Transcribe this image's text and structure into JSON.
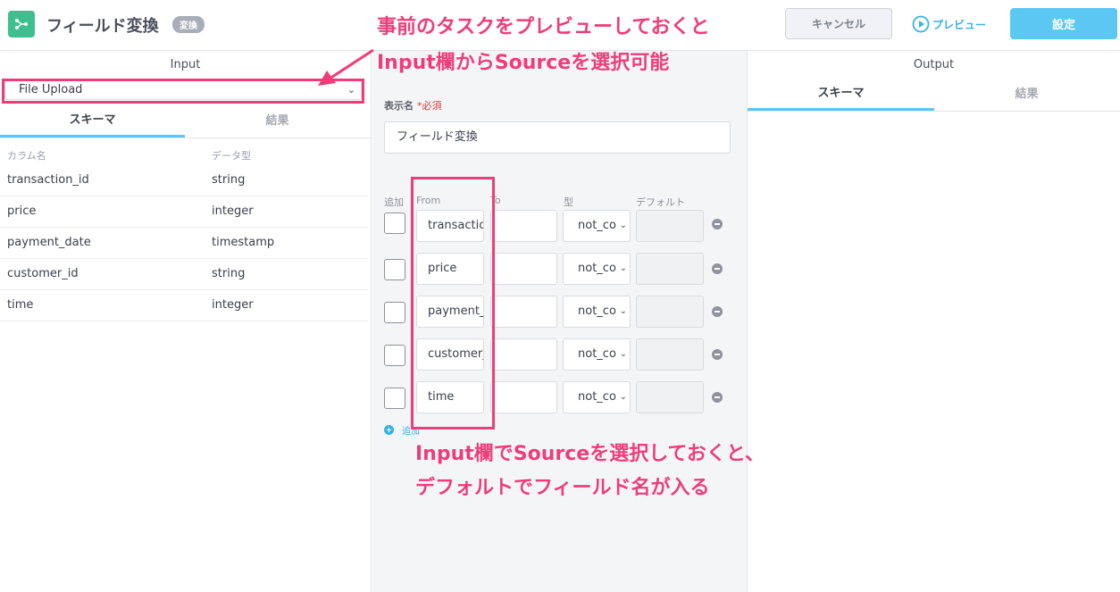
{
  "header": {
    "title": "フィールド変換",
    "badge": "変換",
    "cancel_label": "キャンセル",
    "preview_label": "プレビュー",
    "settings_label": "設定"
  },
  "input_panel": {
    "title": "Input",
    "source_select": "File Upload",
    "tabs": [
      "スキーマ",
      "結果"
    ],
    "columns": [
      "カラム名",
      "データ型"
    ],
    "rows": [
      {
        "name": "transaction_id",
        "type": "string"
      },
      {
        "name": "price",
        "type": "integer"
      },
      {
        "name": "payment_date",
        "type": "timestamp"
      },
      {
        "name": "customer_id",
        "type": "string"
      },
      {
        "name": "time",
        "type": "integer"
      }
    ]
  },
  "form": {
    "display_name_label": "表示名",
    "required_mark": "*必須",
    "display_name_value": "フィールド変換",
    "columns": [
      "追加",
      "From",
      "To",
      "型",
      "デフォルト"
    ],
    "rows": [
      {
        "from": "transactio",
        "to": "",
        "type": "not_co",
        "default": ""
      },
      {
        "from": "price",
        "to": "",
        "type": "not_co",
        "default": ""
      },
      {
        "from": "payment_",
        "to": "",
        "type": "not_co",
        "default": ""
      },
      {
        "from": "customer_",
        "to": "",
        "type": "not_co",
        "default": ""
      },
      {
        "from": "time",
        "to": "",
        "type": "not_co",
        "default": ""
      }
    ],
    "add_label": "追加"
  },
  "output_panel": {
    "title": "Output",
    "tabs": [
      "スキーマ",
      "結果"
    ]
  },
  "annotations": {
    "top_line1": "事前のタスクをプレビューしておくと",
    "top_line2": "Input欄からSourceを選択可能",
    "bottom_line1": "Input欄でSourceを選択しておくと、",
    "bottom_line2": "デフォルトでフィールド名が入る"
  },
  "colors": {
    "accent": "#5ac8f2",
    "annotation": "#f03c79",
    "app_icon": "#3fbf8f"
  }
}
